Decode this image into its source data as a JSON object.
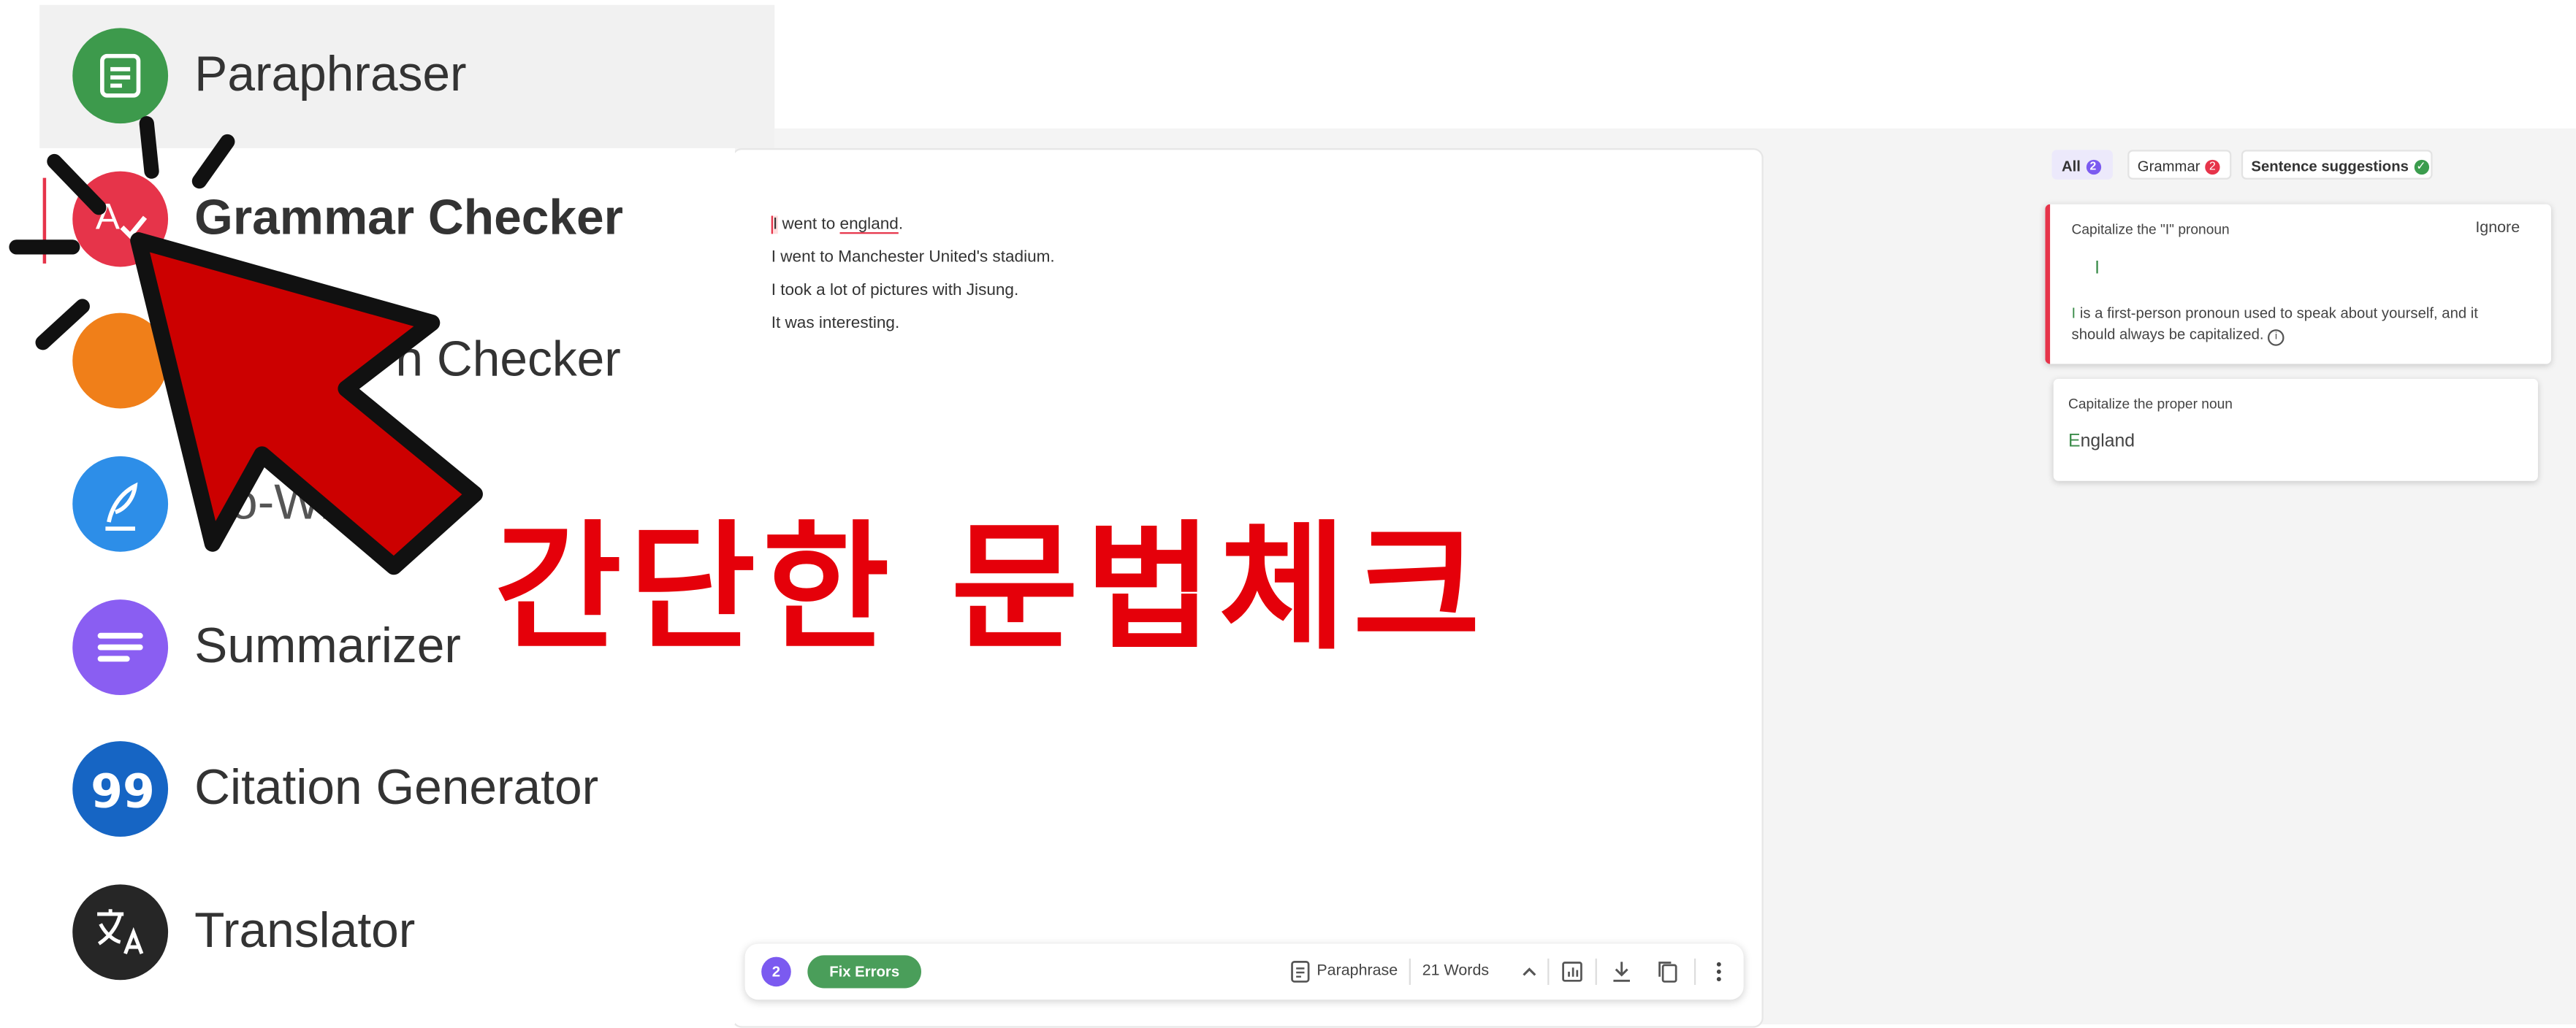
{
  "sidebar": {
    "items": [
      {
        "label": "Paraphraser",
        "color": "#3d9a4c",
        "icon": "paraphraser-icon"
      },
      {
        "label": "Grammar Checker",
        "color": "#e6344a",
        "icon": "grammar-check-icon"
      },
      {
        "label": "Plagiarism Checker",
        "visible_label": "n Checker",
        "color": "#f07f19",
        "icon": "plagiarism-search-icon"
      },
      {
        "label": "Co-Writer",
        "visible_label": "Co-Wri",
        "color": "#2d8ee8",
        "icon": "quill-icon"
      },
      {
        "label": "Summarizer",
        "color": "#8a5ef2",
        "icon": "summary-lines-icon"
      },
      {
        "label": "Citation Generator",
        "color": "#1665c4",
        "icon": "quote-icon"
      },
      {
        "label": "Translator",
        "color": "#262626",
        "icon": "translate-icon"
      }
    ]
  },
  "overlay": {
    "headline": "간단한 문법체크",
    "arrow_color": "#cc0000"
  },
  "editor": {
    "lines": [
      {
        "prefix": "I",
        "middle": " went to ",
        "error": "england",
        "suffix": "."
      },
      {
        "text": "I went to Manchester United's stadium."
      },
      {
        "text": "I took a lot of pictures with Jisung."
      },
      {
        "text": "It was interesting."
      }
    ]
  },
  "toolbar": {
    "error_count": "2",
    "fix_label": "Fix Errors",
    "paraphrase_label": "Paraphrase",
    "word_count": "21 Words"
  },
  "panel": {
    "tabs": [
      {
        "label": "All",
        "count": "2",
        "badge_color": "#7b5af0"
      },
      {
        "label": "Grammar",
        "count": "2",
        "badge_color": "#e6344a"
      },
      {
        "label": "Sentence suggestions",
        "count": "✓",
        "badge_color": "#3b9c4d"
      }
    ],
    "cards": [
      {
        "title": "Capitalize the \"I\" pronoun",
        "ignore": "Ignore",
        "suggestion": "I",
        "description_highlight": "I",
        "description": " is a first-person pronoun used to speak about yourself, and it should always be capitalized."
      },
      {
        "title": "Capitalize the proper noun",
        "suggestion_first": "E",
        "suggestion_rest": "ngland"
      }
    ]
  }
}
